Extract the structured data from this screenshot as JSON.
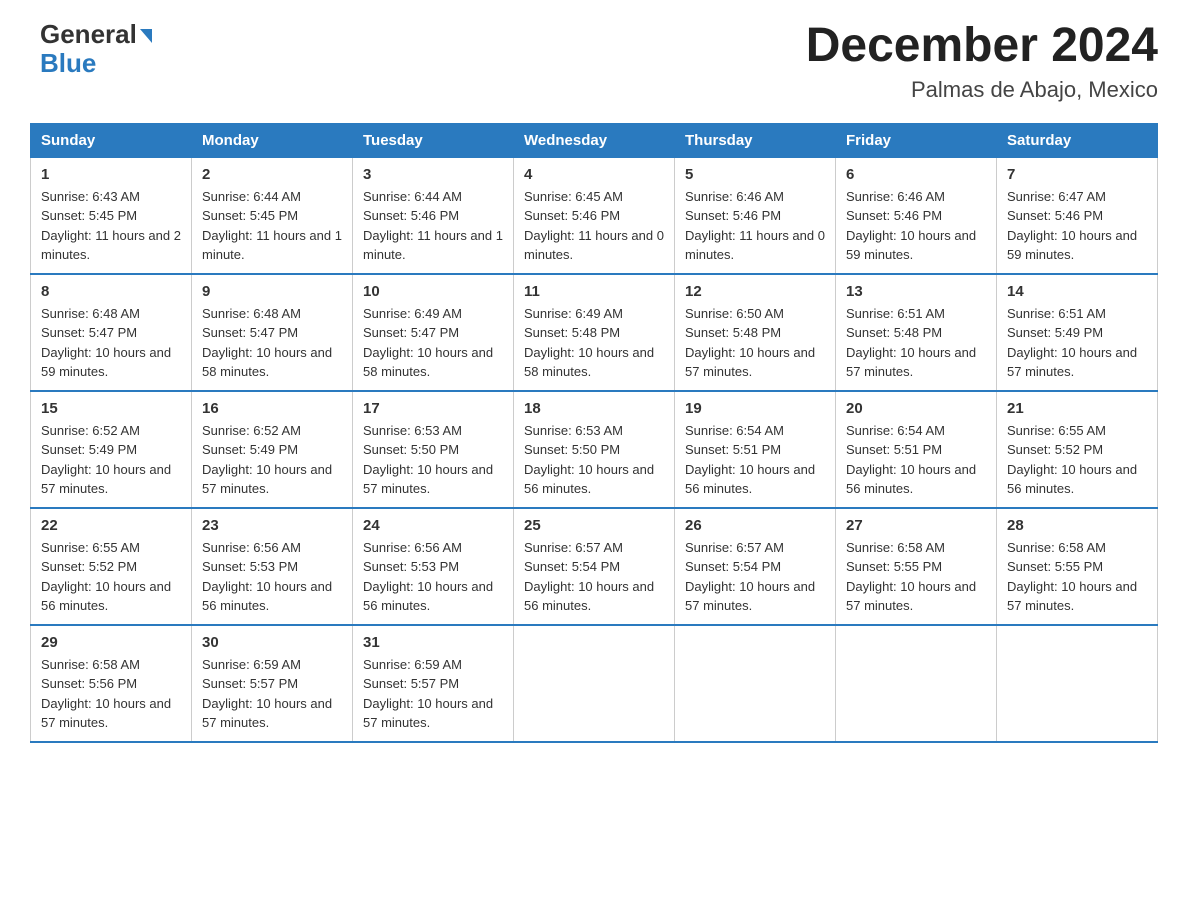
{
  "header": {
    "logo_general": "General",
    "logo_blue": "Blue",
    "month_year": "December 2024",
    "location": "Palmas de Abajo, Mexico"
  },
  "days_of_week": [
    "Sunday",
    "Monday",
    "Tuesday",
    "Wednesday",
    "Thursday",
    "Friday",
    "Saturday"
  ],
  "weeks": [
    [
      {
        "day": "1",
        "sunrise": "Sunrise: 6:43 AM",
        "sunset": "Sunset: 5:45 PM",
        "daylight": "Daylight: 11 hours and 2 minutes."
      },
      {
        "day": "2",
        "sunrise": "Sunrise: 6:44 AM",
        "sunset": "Sunset: 5:45 PM",
        "daylight": "Daylight: 11 hours and 1 minute."
      },
      {
        "day": "3",
        "sunrise": "Sunrise: 6:44 AM",
        "sunset": "Sunset: 5:46 PM",
        "daylight": "Daylight: 11 hours and 1 minute."
      },
      {
        "day": "4",
        "sunrise": "Sunrise: 6:45 AM",
        "sunset": "Sunset: 5:46 PM",
        "daylight": "Daylight: 11 hours and 0 minutes."
      },
      {
        "day": "5",
        "sunrise": "Sunrise: 6:46 AM",
        "sunset": "Sunset: 5:46 PM",
        "daylight": "Daylight: 11 hours and 0 minutes."
      },
      {
        "day": "6",
        "sunrise": "Sunrise: 6:46 AM",
        "sunset": "Sunset: 5:46 PM",
        "daylight": "Daylight: 10 hours and 59 minutes."
      },
      {
        "day": "7",
        "sunrise": "Sunrise: 6:47 AM",
        "sunset": "Sunset: 5:46 PM",
        "daylight": "Daylight: 10 hours and 59 minutes."
      }
    ],
    [
      {
        "day": "8",
        "sunrise": "Sunrise: 6:48 AM",
        "sunset": "Sunset: 5:47 PM",
        "daylight": "Daylight: 10 hours and 59 minutes."
      },
      {
        "day": "9",
        "sunrise": "Sunrise: 6:48 AM",
        "sunset": "Sunset: 5:47 PM",
        "daylight": "Daylight: 10 hours and 58 minutes."
      },
      {
        "day": "10",
        "sunrise": "Sunrise: 6:49 AM",
        "sunset": "Sunset: 5:47 PM",
        "daylight": "Daylight: 10 hours and 58 minutes."
      },
      {
        "day": "11",
        "sunrise": "Sunrise: 6:49 AM",
        "sunset": "Sunset: 5:48 PM",
        "daylight": "Daylight: 10 hours and 58 minutes."
      },
      {
        "day": "12",
        "sunrise": "Sunrise: 6:50 AM",
        "sunset": "Sunset: 5:48 PM",
        "daylight": "Daylight: 10 hours and 57 minutes."
      },
      {
        "day": "13",
        "sunrise": "Sunrise: 6:51 AM",
        "sunset": "Sunset: 5:48 PM",
        "daylight": "Daylight: 10 hours and 57 minutes."
      },
      {
        "day": "14",
        "sunrise": "Sunrise: 6:51 AM",
        "sunset": "Sunset: 5:49 PM",
        "daylight": "Daylight: 10 hours and 57 minutes."
      }
    ],
    [
      {
        "day": "15",
        "sunrise": "Sunrise: 6:52 AM",
        "sunset": "Sunset: 5:49 PM",
        "daylight": "Daylight: 10 hours and 57 minutes."
      },
      {
        "day": "16",
        "sunrise": "Sunrise: 6:52 AM",
        "sunset": "Sunset: 5:49 PM",
        "daylight": "Daylight: 10 hours and 57 minutes."
      },
      {
        "day": "17",
        "sunrise": "Sunrise: 6:53 AM",
        "sunset": "Sunset: 5:50 PM",
        "daylight": "Daylight: 10 hours and 57 minutes."
      },
      {
        "day": "18",
        "sunrise": "Sunrise: 6:53 AM",
        "sunset": "Sunset: 5:50 PM",
        "daylight": "Daylight: 10 hours and 56 minutes."
      },
      {
        "day": "19",
        "sunrise": "Sunrise: 6:54 AM",
        "sunset": "Sunset: 5:51 PM",
        "daylight": "Daylight: 10 hours and 56 minutes."
      },
      {
        "day": "20",
        "sunrise": "Sunrise: 6:54 AM",
        "sunset": "Sunset: 5:51 PM",
        "daylight": "Daylight: 10 hours and 56 minutes."
      },
      {
        "day": "21",
        "sunrise": "Sunrise: 6:55 AM",
        "sunset": "Sunset: 5:52 PM",
        "daylight": "Daylight: 10 hours and 56 minutes."
      }
    ],
    [
      {
        "day": "22",
        "sunrise": "Sunrise: 6:55 AM",
        "sunset": "Sunset: 5:52 PM",
        "daylight": "Daylight: 10 hours and 56 minutes."
      },
      {
        "day": "23",
        "sunrise": "Sunrise: 6:56 AM",
        "sunset": "Sunset: 5:53 PM",
        "daylight": "Daylight: 10 hours and 56 minutes."
      },
      {
        "day": "24",
        "sunrise": "Sunrise: 6:56 AM",
        "sunset": "Sunset: 5:53 PM",
        "daylight": "Daylight: 10 hours and 56 minutes."
      },
      {
        "day": "25",
        "sunrise": "Sunrise: 6:57 AM",
        "sunset": "Sunset: 5:54 PM",
        "daylight": "Daylight: 10 hours and 56 minutes."
      },
      {
        "day": "26",
        "sunrise": "Sunrise: 6:57 AM",
        "sunset": "Sunset: 5:54 PM",
        "daylight": "Daylight: 10 hours and 57 minutes."
      },
      {
        "day": "27",
        "sunrise": "Sunrise: 6:58 AM",
        "sunset": "Sunset: 5:55 PM",
        "daylight": "Daylight: 10 hours and 57 minutes."
      },
      {
        "day": "28",
        "sunrise": "Sunrise: 6:58 AM",
        "sunset": "Sunset: 5:55 PM",
        "daylight": "Daylight: 10 hours and 57 minutes."
      }
    ],
    [
      {
        "day": "29",
        "sunrise": "Sunrise: 6:58 AM",
        "sunset": "Sunset: 5:56 PM",
        "daylight": "Daylight: 10 hours and 57 minutes."
      },
      {
        "day": "30",
        "sunrise": "Sunrise: 6:59 AM",
        "sunset": "Sunset: 5:57 PM",
        "daylight": "Daylight: 10 hours and 57 minutes."
      },
      {
        "day": "31",
        "sunrise": "Sunrise: 6:59 AM",
        "sunset": "Sunset: 5:57 PM",
        "daylight": "Daylight: 10 hours and 57 minutes."
      },
      {
        "day": "",
        "sunrise": "",
        "sunset": "",
        "daylight": ""
      },
      {
        "day": "",
        "sunrise": "",
        "sunset": "",
        "daylight": ""
      },
      {
        "day": "",
        "sunrise": "",
        "sunset": "",
        "daylight": ""
      },
      {
        "day": "",
        "sunrise": "",
        "sunset": "",
        "daylight": ""
      }
    ]
  ]
}
